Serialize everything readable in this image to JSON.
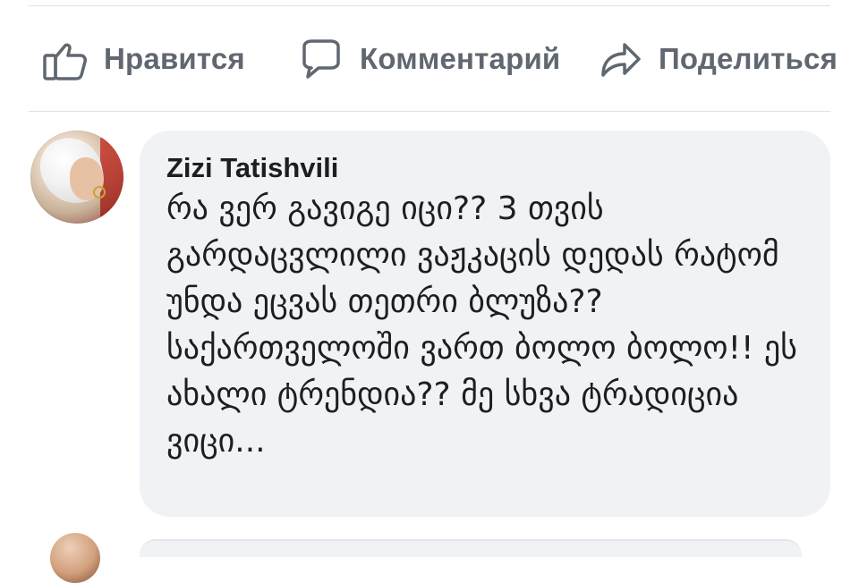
{
  "actions": {
    "like": {
      "label": "Нравится",
      "icon": "thumbs-up-icon"
    },
    "comment": {
      "label": "Комментарий",
      "icon": "speech-bubble-icon"
    },
    "share": {
      "label": "Поделиться",
      "icon": "share-arrow-icon"
    }
  },
  "comment": {
    "author": "Zizi Tatishvili",
    "text": "რა ვერ გავიგე იცი?? 3 თვის გარდაცვლილი ვაჟკაცის დედას რატომ უნდა ეცვას თეთრი ბლუზა?? საქართველოში ვართ ბოლო ბოლო!! ეს ახალი ტრენდია?? მე სხვა ტრადიცია ვიცი..."
  },
  "colors": {
    "label_gray": "#606770",
    "bubble_bg": "#f0f2f5",
    "divider": "#dddfe2",
    "text": "#1c1e21"
  }
}
